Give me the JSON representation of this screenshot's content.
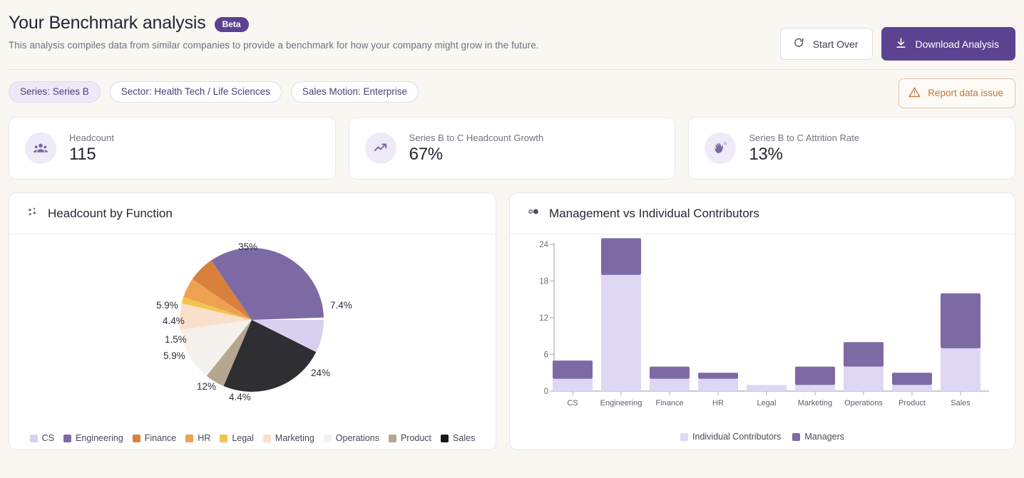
{
  "header": {
    "title": "Your Benchmark analysis",
    "badge": "Beta",
    "subtitle": "This analysis compiles data from similar companies to provide a benchmark for how your company might grow in the future.",
    "start_over_label": "Start Over",
    "download_label": "Download Analysis"
  },
  "filters": {
    "chips": [
      {
        "label": "Series: Series B",
        "filled": true
      },
      {
        "label": "Sector: Health Tech / Life Sciences",
        "filled": false
      },
      {
        "label": "Sales Motion: Enterprise",
        "filled": false
      }
    ],
    "report_label": "Report data issue"
  },
  "stats": [
    {
      "icon": "people-icon",
      "label": "Headcount",
      "value": "115"
    },
    {
      "icon": "trend-up-icon",
      "label": "Series B to C Headcount Growth",
      "value": "67%"
    },
    {
      "icon": "waving-hand-icon",
      "label": "Series B to C Attrition Rate",
      "value": "13%"
    }
  ],
  "cards": {
    "pie": {
      "icon": "scatter-dots-icon",
      "title": "Headcount by Function"
    },
    "bar": {
      "icon": "two-circles-icon",
      "title": "Management vs Individual Contributors"
    }
  },
  "colors": {
    "accent": "#5c4391",
    "page_bg": "#faf7f3",
    "card_bg": "#ffffff",
    "warn": "#c2793f",
    "ic": "#ded7f4",
    "managers": "#7d6aa5"
  },
  "chart_data": [
    {
      "type": "pie",
      "title": "Headcount by Function",
      "labels_shown": [
        "35%",
        "7.4%",
        "24%",
        "4.4%",
        "12%",
        "5.9%",
        "1.5%",
        "4.4%",
        "5.9%"
      ],
      "categories": [
        "CS",
        "Engineering",
        "Finance",
        "HR",
        "Legal",
        "Marketing",
        "Operations",
        "Product",
        "Sales"
      ],
      "values": [
        7.4,
        35,
        5.9,
        4.4,
        1.5,
        5.9,
        12,
        4.4,
        24
      ],
      "colors": [
        "#d9d0f0",
        "#7d6aa5",
        "#d9803c",
        "#eda martian",
        "#f2c44d",
        "#fae0ca",
        "#f4f1ec",
        "#b5a68f",
        "#2f2f33"
      ],
      "slice_colors": [
        "#d9d0f0",
        "#7d6aa5",
        "#d9803c",
        "#eea151",
        "#f2c44d",
        "#fae0ca",
        "#f4f1ec",
        "#b5a68f",
        "#2f2f33"
      ],
      "legend_position": "bottom",
      "unit": "%"
    },
    {
      "type": "bar",
      "stacked": true,
      "title": "Management vs Individual Contributors",
      "categories": [
        "CS",
        "Engineering",
        "Finance",
        "HR",
        "Legal",
        "Marketing",
        "Operations",
        "Product",
        "Sales"
      ],
      "series": [
        {
          "name": "Individual Contributors",
          "color": "#ded7f4",
          "values": [
            2,
            19,
            2,
            2,
            1,
            1,
            4,
            1,
            7
          ]
        },
        {
          "name": "Managers",
          "color": "#7d6aa5",
          "values": [
            3,
            6,
            2,
            1,
            0,
            3,
            4,
            2,
            9
          ]
        }
      ],
      "yticks": [
        0,
        6,
        12,
        18,
        24
      ],
      "ylim": [
        0,
        25
      ],
      "grid": false,
      "legend_position": "bottom",
      "xlabel": "",
      "ylabel": ""
    }
  ]
}
